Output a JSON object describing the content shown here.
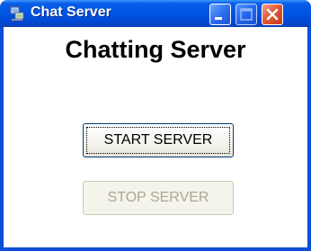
{
  "window": {
    "title": "Chat Server",
    "app_icon": "chat-server-app-icon",
    "controls": {
      "minimize_icon": "minimize-icon",
      "maximize_icon": "maximize-icon",
      "close_icon": "close-icon",
      "maximize_enabled": false
    }
  },
  "main": {
    "heading": "Chatting Server",
    "start_button": {
      "label": "START SERVER",
      "enabled": true,
      "focused": true
    },
    "stop_button": {
      "label": "STOP SERVER",
      "enabled": false
    }
  },
  "colors": {
    "titlebar": "#0055e5",
    "close_button": "#e35b36",
    "disabled_text": "#aca899"
  }
}
